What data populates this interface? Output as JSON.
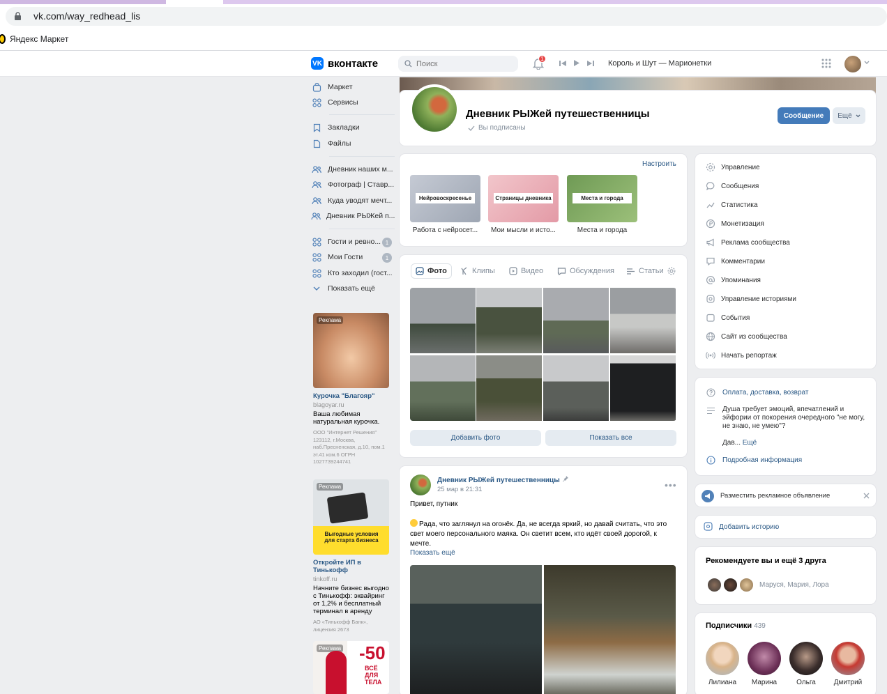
{
  "browser": {
    "url": "vk.com/way_redhead_lis",
    "bookmark": "Яндекс Маркет"
  },
  "header": {
    "logo_text": "вконтакте",
    "search_placeholder": "Поиск",
    "notifications_count": "1",
    "now_playing": "Король и Шут — Марионетки"
  },
  "sidebar": {
    "items": [
      {
        "label": "Маркет",
        "icon": "bag-icon"
      },
      {
        "label": "Сервисы",
        "icon": "grid-icon"
      },
      {
        "label": "Закладки",
        "icon": "bookmark-icon"
      },
      {
        "label": "Файлы",
        "icon": "file-icon"
      },
      {
        "label": "Дневник наших м...",
        "icon": "group-icon"
      },
      {
        "label": "Фотограф | Ставр...",
        "icon": "group-icon"
      },
      {
        "label": "Куда уводят мечт...",
        "icon": "group-icon"
      },
      {
        "label": "Дневник РЫЖей п...",
        "icon": "group-icon"
      },
      {
        "label": "Гости и ревно...",
        "icon": "grid-icon",
        "count": "1"
      },
      {
        "label": "Мои Гости",
        "icon": "grid-icon",
        "count": "1"
      },
      {
        "label": "Кто заходил (гост...",
        "icon": "grid-icon"
      },
      {
        "label": "Показать ещё",
        "icon": "chevron-down-icon"
      }
    ]
  },
  "ads": [
    {
      "badge": "Реклама",
      "title": "Курочка \"Благояр\"",
      "domain": "blagoyar.ru",
      "desc": "Ваша любимая натуральная курочка.",
      "legal": "ООО \"Интернет Решения\" 123112, г.Москва, наб.Пресненская, д.10, пом.1 эт.41 ком.6 ОГРН 1027739244741"
    },
    {
      "badge": "Реклама",
      "banner_text": "Выгодные условия для старта бизнеса",
      "title": "Откройте ИП в Тинькофф",
      "domain": "tinkoff.ru",
      "desc": "Начните бизнес выгодно с Тинькофф: эквайринг от 1,2% и бесплатный терминал в аренду",
      "legal": "АО «Тинькофф Банк», лицензия 2673"
    },
    {
      "badge": "Реклама",
      "banner_big": "-50",
      "banner_sub": "ВСЁ ДЛЯ ТЕЛА"
    }
  ],
  "profile": {
    "name": "Дневник РЫЖей путешественницы",
    "status": "Вы подписаны",
    "message_button": "Сообщение",
    "more_button": "Ещё"
  },
  "albums": {
    "settings_link": "Настроить",
    "items": [
      {
        "label": "Нейровоскресенье",
        "caption": "Работа с нейросет..."
      },
      {
        "label": "Страницы дневника",
        "caption": "Мои мысли и исто..."
      },
      {
        "label": "Места и города",
        "caption": "Места и города"
      }
    ]
  },
  "media_tabs": [
    "Фото",
    "Клипы",
    "Видео",
    "Обсуждения",
    "Статьи"
  ],
  "media_buttons": {
    "add": "Добавить фото",
    "show_all": "Показать все"
  },
  "post": {
    "author": "Дневник РЫЖей путешественницы",
    "date": "25 мар в 21:31",
    "greeting": "Привет, путник",
    "body": "Рада, что заглянул на огонёк. Да, не всегда яркий, но давай считать, что это свет моего персонального маяка. Он светит всем, кто идёт своей дорогой, к мечте.",
    "show_more": "Показать ещё"
  },
  "admin_menu": [
    {
      "label": "Управление",
      "icon": "gear-icon"
    },
    {
      "label": "Сообщения",
      "icon": "chat-icon"
    },
    {
      "label": "Статистика",
      "icon": "chart-icon"
    },
    {
      "label": "Монетизация",
      "icon": "coin-icon"
    },
    {
      "label": "Реклама сообщества",
      "icon": "megaphone-icon"
    },
    {
      "label": "Комментарии",
      "icon": "comment-icon"
    },
    {
      "label": "Упоминания",
      "icon": "at-icon"
    },
    {
      "label": "Управление историями",
      "icon": "story-icon"
    },
    {
      "label": "События",
      "icon": "calendar-icon"
    },
    {
      "label": "Сайт из сообщества",
      "icon": "globe-icon"
    },
    {
      "label": "Начать репортаж",
      "icon": "broadcast-icon"
    }
  ],
  "info": {
    "link": "Оплата, доставка, возврат",
    "description": "Душа требует эмоций, впечатлений и эйфории от покорения очередного \"не могу, не знаю, не умею\"?",
    "description_tail": "Дав...",
    "more": "Ещё",
    "details": "Подробная информация"
  },
  "advertise": {
    "label": "Разместить рекламное объявление"
  },
  "story": {
    "label": "Добавить историю"
  },
  "recommend": {
    "title": "Рекомендуете вы и ещё 3 друга",
    "names": "Маруся, Мария, Лора"
  },
  "subscribers": {
    "title": "Подписчики",
    "count": "439",
    "people": [
      "Лилиана",
      "Марина",
      "Ольга",
      "Дмитрий"
    ]
  },
  "colors": {
    "accent": "#447bba",
    "link": "#2a5885",
    "background": "#edeef0"
  }
}
